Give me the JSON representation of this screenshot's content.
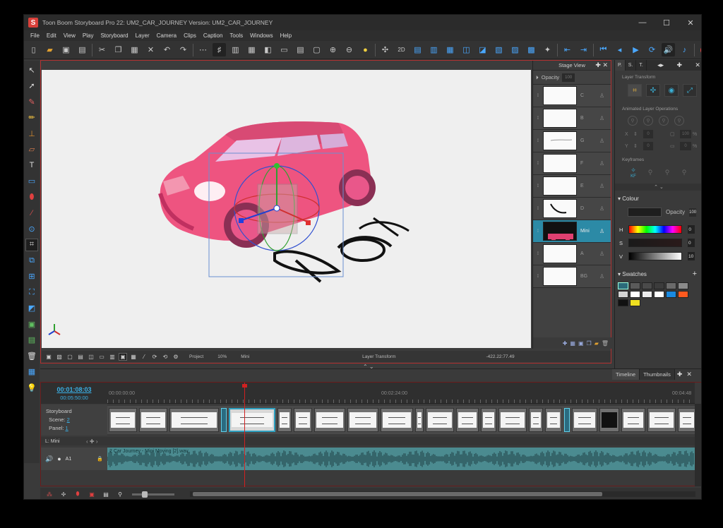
{
  "window": {
    "logo": "S",
    "title": "Toon Boom Storyboard Pro 22: UM2_CAR_JOURNEY Version: UM2_CAR_JOURNEY",
    "minimize": "—",
    "maximize": "☐",
    "close": "✕"
  },
  "menu": [
    "File",
    "Edit",
    "View",
    "Play",
    "Storyboard",
    "Layer",
    "Camera",
    "Clips",
    "Caption",
    "Tools",
    "Windows",
    "Help"
  ],
  "stage_view": {
    "title": "Stage View",
    "opacity_label": "Opacity",
    "opacity_value": "100",
    "layers": [
      {
        "name": "C"
      },
      {
        "name": "B"
      },
      {
        "name": "G"
      },
      {
        "name": "F"
      },
      {
        "name": "E"
      },
      {
        "name": "D"
      },
      {
        "name": "Mini",
        "selected": true
      },
      {
        "name": "A"
      },
      {
        "name": "BG"
      }
    ]
  },
  "stage_bar": {
    "project": "Project",
    "zoom": "10%",
    "layer": "Mini",
    "mode": "Layer Transform",
    "coords": "-422.22:77.49"
  },
  "right_panel": {
    "tabs": [
      "P.",
      "S.",
      "T."
    ],
    "layer_transform": "Layer Transform",
    "animated_ops": "Animated Layer Operations",
    "keyframes": "Keyframes",
    "kf_label": "KF",
    "x_label": "X",
    "y_label": "Y",
    "x_val": "0",
    "y_val": "0",
    "w_val": "100",
    "h_val": "0",
    "pct": "%",
    "colour_title": "Colour",
    "colour_opacity": "Opacity",
    "colour_opacity_val": "100",
    "h_label": "H",
    "s_label": "S",
    "v_label": "V",
    "s_val": "0",
    "v_val": "10",
    "swatches_title": "Swatches",
    "swatch_colors": [
      "#2b6a7a",
      "#5a5a5a",
      "#4a4a4a",
      "#3c3c3c",
      "#6a6a6a",
      "#8a8a8a",
      "#d4d4d4",
      "#ffffff",
      "#ededed",
      "#ffffff",
      "#1a8ae0",
      "#ff5a1f",
      "#111111",
      "#f0e020"
    ]
  },
  "timeline": {
    "tabs": [
      "Timeline",
      "Thumbnails"
    ],
    "current_time": "00:01:08:03",
    "total_time": "00:05:50:00",
    "ruler_start": "00:00:00:00",
    "ruler_mid": "00:02:24:00",
    "ruler_end": "00:04:48",
    "storyboard_label": "Storyboard",
    "scene_label": "Scene:",
    "scene_value": "2",
    "panel_label": "Panel:",
    "panel_value": "1",
    "layer_line": "L: Mini",
    "audio_track": "A1",
    "audio_clip": "2 Car Journey - Mini Moving [2].wav"
  },
  "colors": {
    "accent": "#3ab0e6",
    "selection": "#2c8aa6",
    "playhead": "#d02020",
    "car": "#f05a7e"
  }
}
